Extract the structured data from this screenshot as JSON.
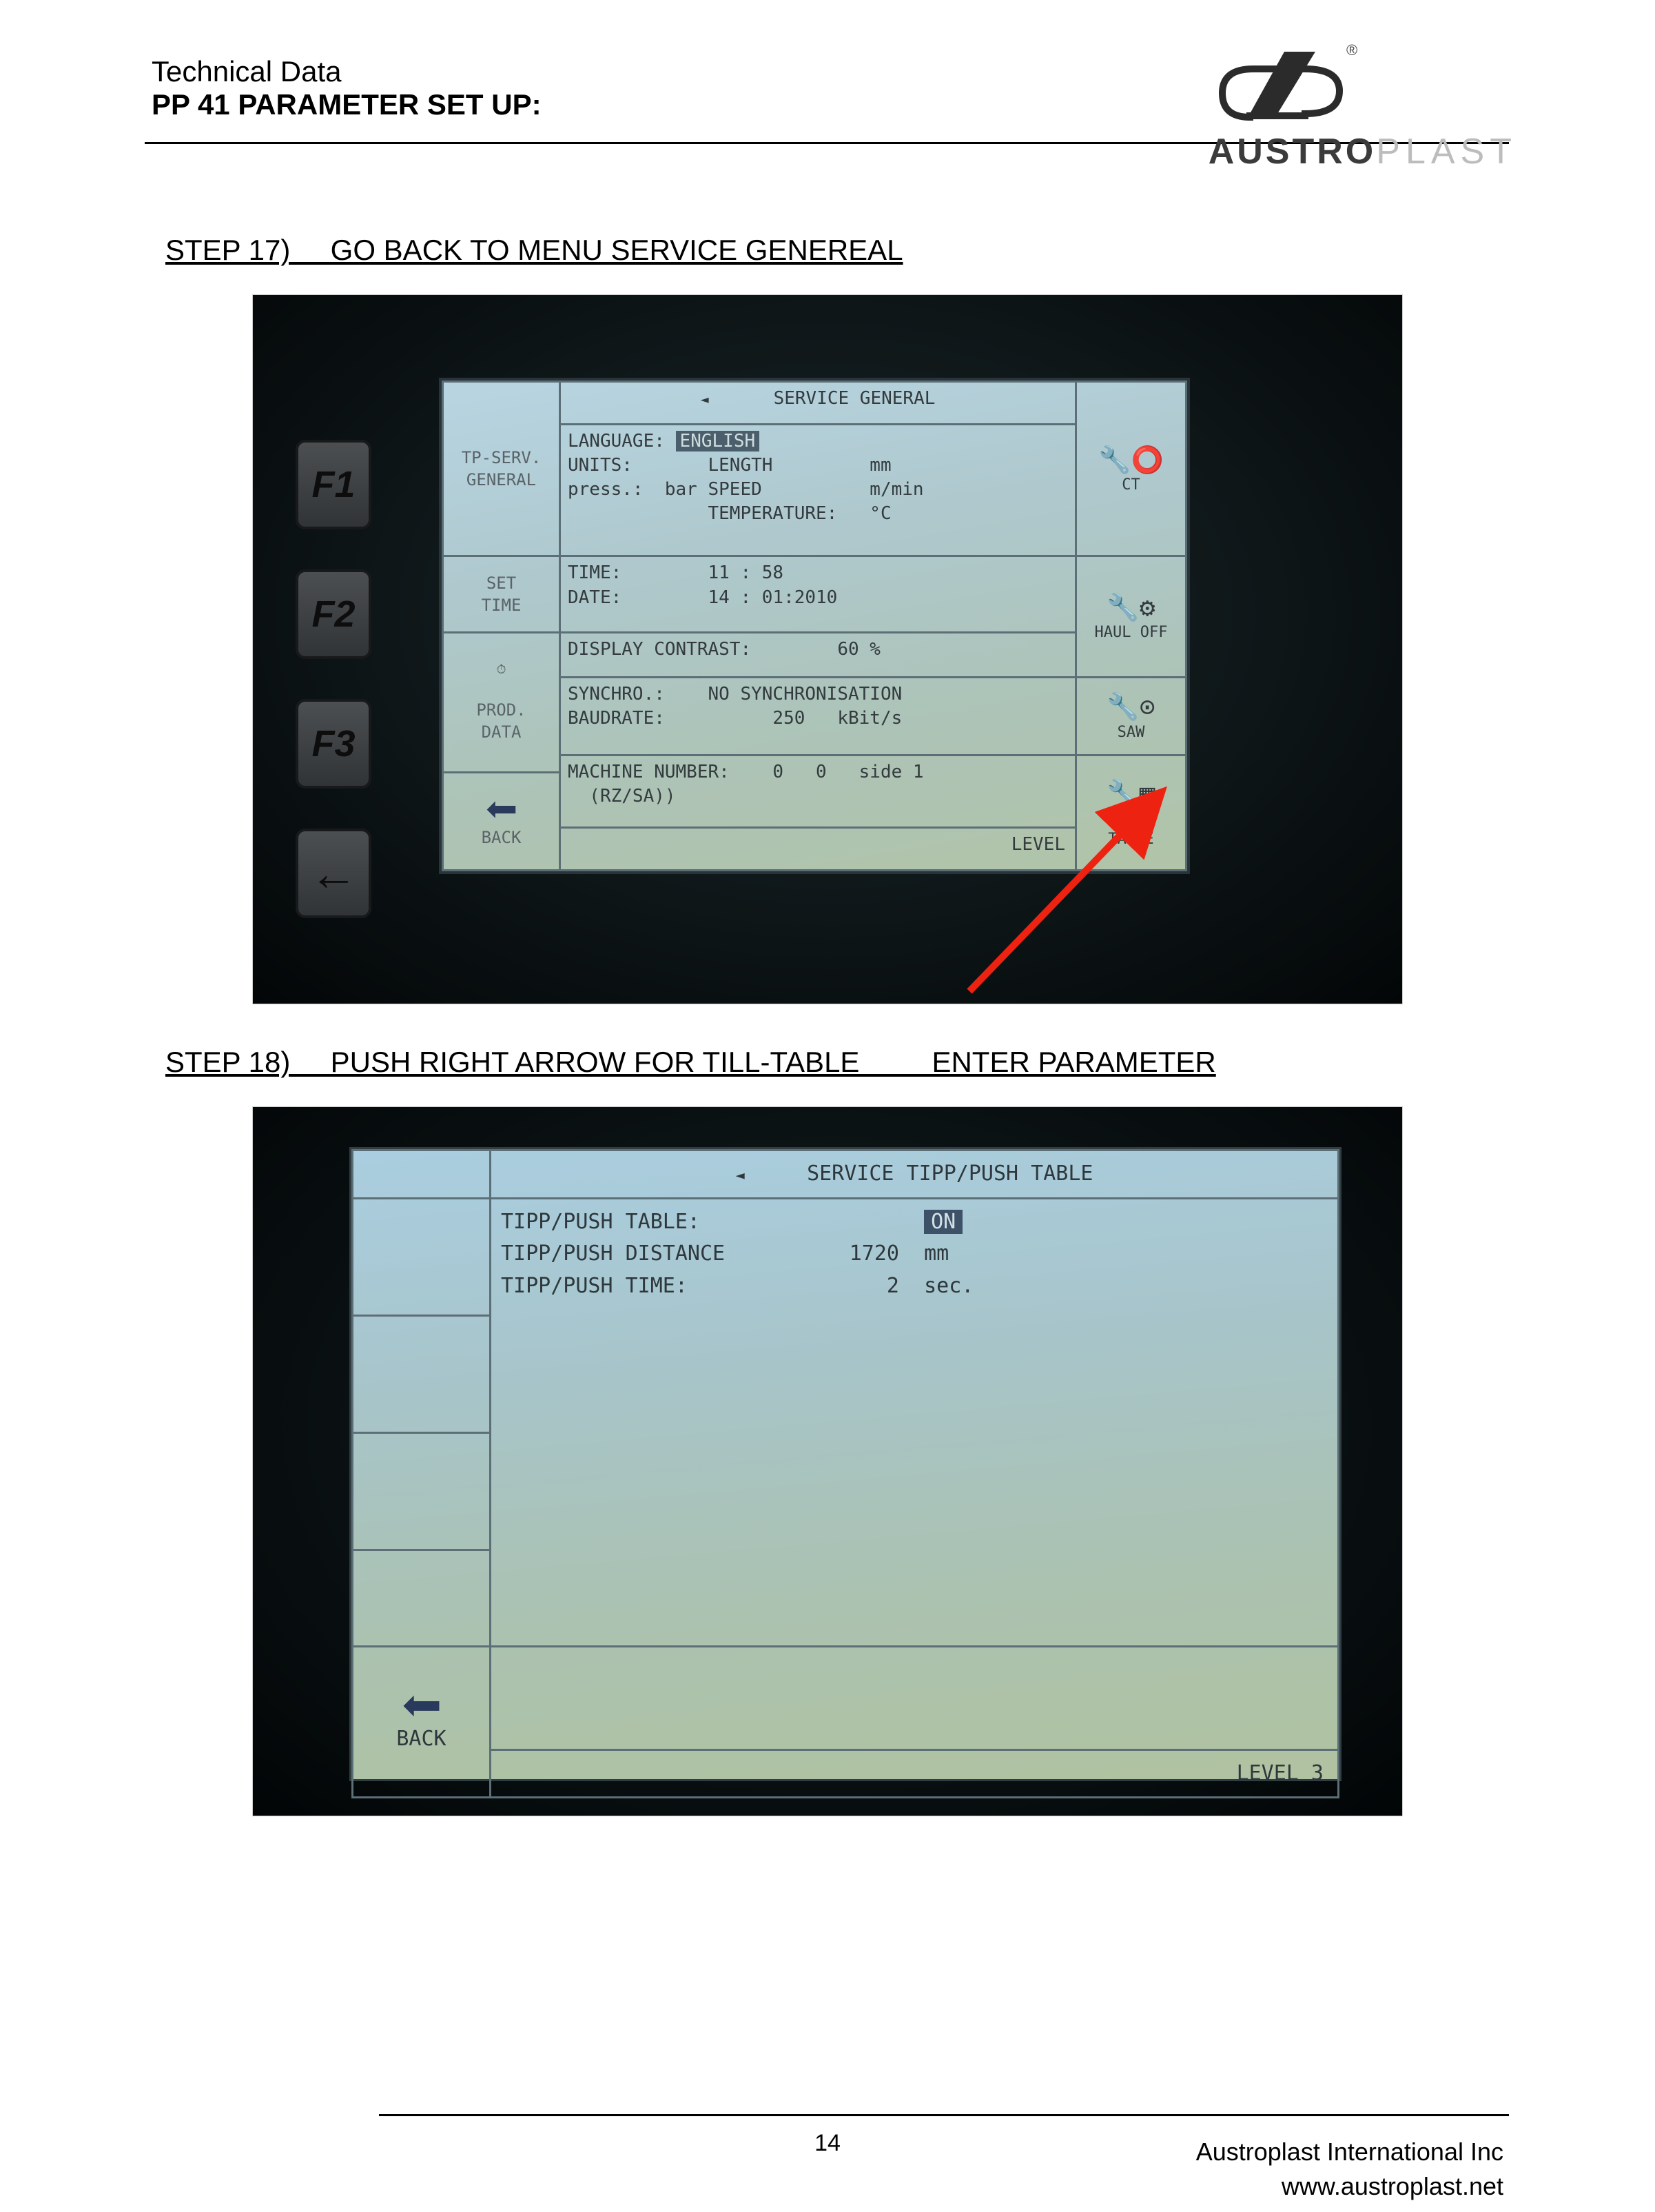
{
  "header": {
    "subtitle": "Technical Data",
    "title": "PP 41 PARAMETER SET UP:",
    "brand_bold": "AUSTRO",
    "brand_light": "PLAST",
    "registered": "®"
  },
  "steps": {
    "s17": "STEP 17)     GO BACK TO MENU SERVICE GENEREAL",
    "s18": "STEP 18)     PUSH RIGHT ARROW FOR TILL-TABLE         ENTER PARAMETER"
  },
  "fkeys": {
    "f1": "F1",
    "f2": "F2",
    "f3": "F3",
    "arrow": "←"
  },
  "screen1": {
    "title": "SERVICE GENERAL",
    "nav1": "TP-SERV.\nGENERAL",
    "nav2": "SET\nTIME",
    "nav3_top": "PROD.\nDATA",
    "nav_back": "BACK",
    "side1": "CT",
    "side2": "HAUL OFF",
    "side3": "SAW",
    "side4": "TIPP-\nTABLE",
    "lang_label": "LANGUAGE:",
    "lang_val": "ENGLISH",
    "units_line": "UNITS:       LENGTH         mm",
    "press_line": "press.:  bar SPEED          m/min",
    "temp_line": "             TEMPERATURE:   °C",
    "time_line": "TIME:        11 : 58",
    "date_line": "DATE:        14 : 01:2010",
    "contrast": "DISPLAY CONTRAST:        60 %",
    "synchro": "SYNCHRO.:    NO SYNCHRONISATION",
    "baud": "BAUDRATE:          250   kBit/s",
    "machnum": "MACHINE NUMBER:    0   0   side 1\n  (RZ/SA))",
    "level": "LEVEL"
  },
  "screen2": {
    "title": "SERVICE TIPP/PUSH TABLE",
    "row1_label": "TIPP/PUSH TABLE:",
    "row1_val": "ON",
    "row2": "TIPP/PUSH DISTANCE          1720  mm",
    "row3": "TIPP/PUSH TIME:                2  sec.",
    "nav_back": "BACK",
    "level": "LEVEL 3"
  },
  "footer": {
    "page": "14",
    "company": "Austroplast International Inc",
    "url": "www.austroplast.net"
  }
}
